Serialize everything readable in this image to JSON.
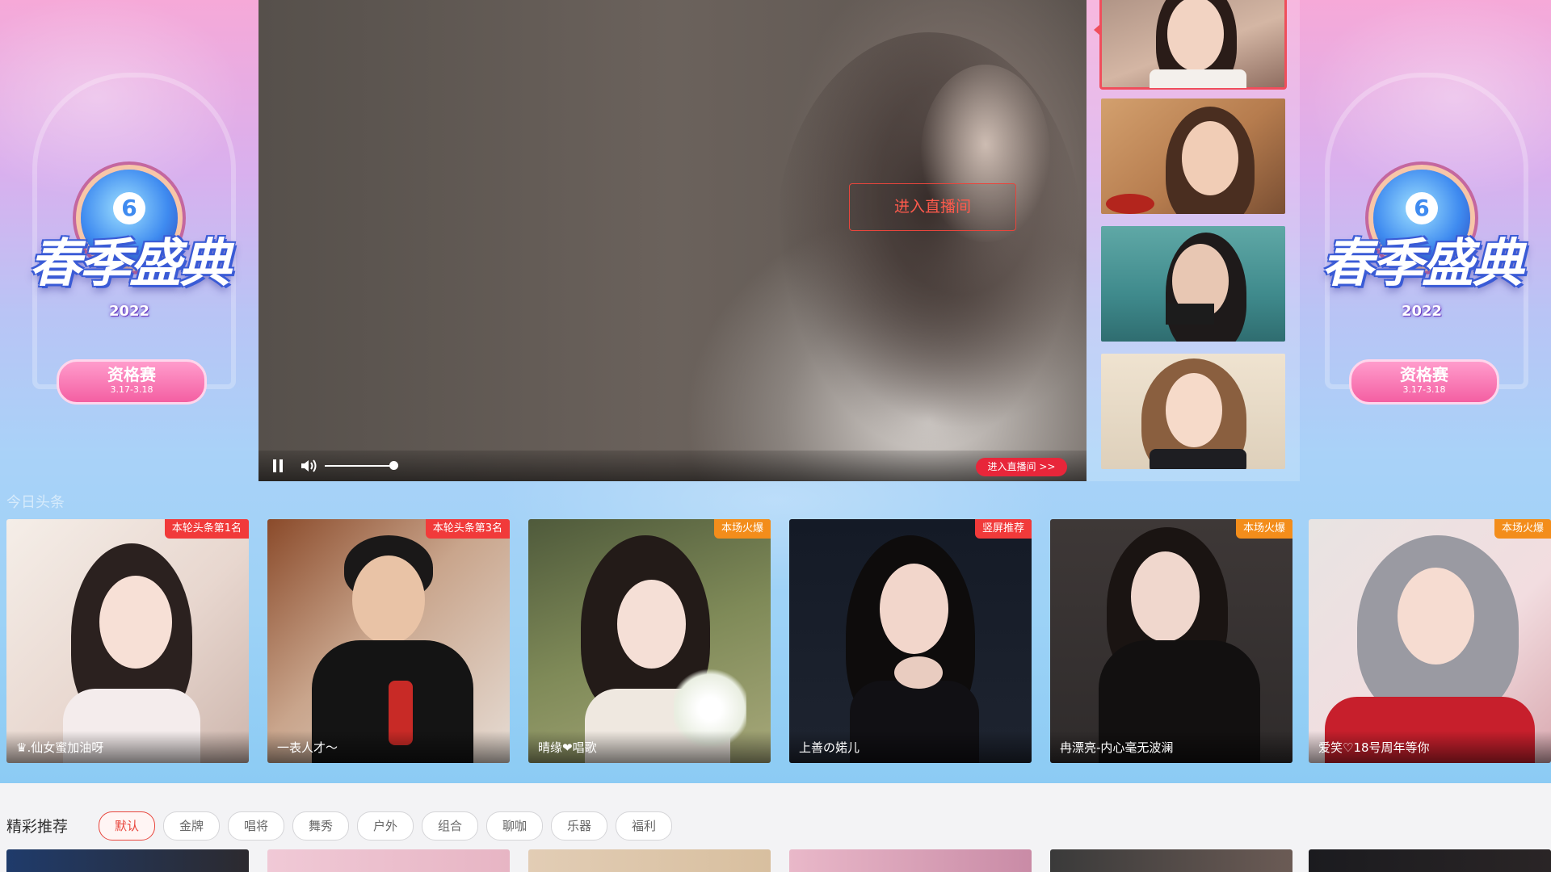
{
  "hero": {
    "section_label": "今日头条",
    "side_logo": {
      "title": "春季盛典",
      "year": "2022",
      "stage": "资格赛",
      "dates": "3.17-3.18",
      "emblem_glyph": "6"
    }
  },
  "player": {
    "enter_button": "进入直播间",
    "enter_small": "进入直播间 >>",
    "controls": {
      "pause_icon": "pause-icon",
      "volume_icon": "volume-icon",
      "volume_level": 0.95
    }
  },
  "thumbs": [
    {
      "id": "thumb-1",
      "active": true
    },
    {
      "id": "thumb-2",
      "active": false
    },
    {
      "id": "thumb-3",
      "active": false
    },
    {
      "id": "thumb-4",
      "active": false
    }
  ],
  "cards": [
    {
      "badge": "本轮头条第1名",
      "badge_color": "#f13a3a",
      "name": "♛.仙女蜜加油呀"
    },
    {
      "badge": "本轮头条第3名",
      "badge_color": "#f13a3a",
      "name": "一表人才～"
    },
    {
      "badge": "本场火爆",
      "badge_color": "#f38d1b",
      "name": "晴缘❤唱歌"
    },
    {
      "badge": "竖屏推荐",
      "badge_color": "#f13a3a",
      "name": "上善の婼儿"
    },
    {
      "badge": "本场火爆",
      "badge_color": "#f38d1b",
      "name": "冉漂亮-内心毫无波澜"
    },
    {
      "badge": "本场火爆",
      "badge_color": "#f38d1b",
      "name": "爱笑♡18号周年等你"
    }
  ],
  "recommend": {
    "title": "精彩推荐",
    "chips": [
      "默认",
      "金牌",
      "唱将",
      "舞秀",
      "户外",
      "组合",
      "聊咖",
      "乐器",
      "福利"
    ],
    "active_chip": "默认"
  },
  "colors": {
    "accent": "#e8453c",
    "badge_red": "#f13a3a",
    "badge_orange": "#f38d1b",
    "enter_small_bg": "#e8263a"
  }
}
